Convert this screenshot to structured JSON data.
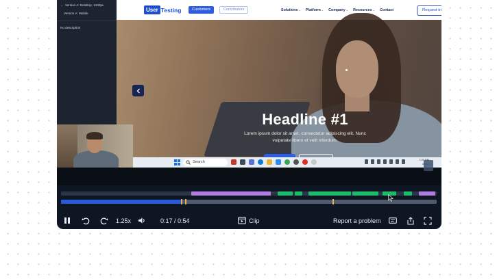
{
  "sidebar": {
    "versions": [
      "Version A: Desktop, 1440px",
      "Version A: Mobile"
    ],
    "description": "No description"
  },
  "website": {
    "logo_user": "User",
    "logo_testing": "Testing",
    "tabs": [
      "Customers",
      "Contributors"
    ],
    "nav": [
      "Solutions",
      "Platform",
      "Company",
      "Resources",
      "Contact"
    ],
    "nav_chevron": "⌄",
    "cta": "Request tri",
    "headline": "Headline #1",
    "subtext_line1": "Lorem ipsum dolor sit amet, consectetur adipiscing elit. Nunc",
    "subtext_line2": "vulputate libero et velit interdum."
  },
  "taskbar": {
    "search_placeholder": "Search",
    "clock_time": "7:25 PM",
    "clock_date": "4/9/..."
  },
  "timeline": {
    "progress_fraction": 0.32,
    "segments": [
      {
        "start": 0.346,
        "end": 0.558,
        "color": "#b07ce0"
      },
      {
        "start": 0.577,
        "end": 0.617,
        "color": "#1fb96a"
      },
      {
        "start": 0.622,
        "end": 0.642,
        "color": "#1fb96a"
      },
      {
        "start": 0.659,
        "end": 0.772,
        "color": "#1fb96a"
      },
      {
        "start": 0.776,
        "end": 0.845,
        "color": "#1fb96a"
      },
      {
        "start": 0.856,
        "end": 0.893,
        "color": "#1fb96a"
      },
      {
        "start": 0.912,
        "end": 0.934,
        "color": "#1fb96a"
      },
      {
        "start": 0.952,
        "end": 0.996,
        "color": "#b07ce0"
      }
    ],
    "markers": [
      0.32,
      0.331,
      0.722
    ]
  },
  "controls": {
    "speed": "1.25x",
    "time": "0:17 / 0:54",
    "clip_label": "Clip",
    "report_label": "Report a problem",
    "icons": {
      "pause": "pause-icon",
      "rewind": "rewind-icon",
      "forward": "forward-icon",
      "volume": "volume-icon",
      "clip": "clip-icon",
      "captions": "captions-icon",
      "share": "share-icon",
      "fullscreen": "fullscreen-icon"
    }
  },
  "colors": {
    "accent": "#2b5ad8",
    "player_bg": "#0f1623",
    "purple_segment": "#b07ce0",
    "green_segment": "#1fb96a"
  }
}
